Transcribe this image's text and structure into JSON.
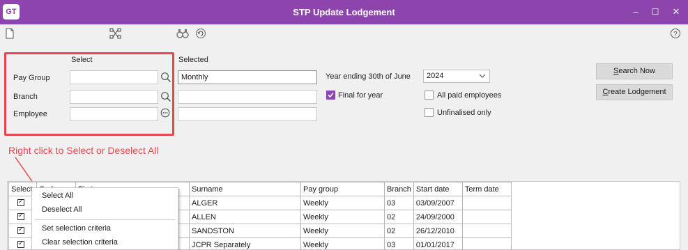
{
  "window": {
    "logo": "GT",
    "title": "STP Update Lodgement",
    "minimize": "–",
    "maximize": "☐",
    "close": "✕"
  },
  "toolbar": {
    "icons": [
      "new-document-icon",
      "hierarchy-icon",
      "binoculars-icon",
      "refresh-icon",
      "help-icon"
    ],
    "help": "?"
  },
  "criteria": {
    "select_header": "Select",
    "selected_header": "Selected",
    "rows": [
      {
        "label": "Pay Group",
        "select_value": "",
        "selected_value": "Monthly"
      },
      {
        "label": "Branch",
        "select_value": "",
        "selected_value": ""
      },
      {
        "label": "Employee",
        "select_value": "",
        "selected_value": ""
      }
    ]
  },
  "options": {
    "year_label": "Year ending 30th of June",
    "year_value": "2024",
    "final_for_year": {
      "label": "Final for year",
      "checked": true
    },
    "all_paid": {
      "label": "All paid employees",
      "checked": false
    },
    "unfinalised": {
      "label": "Unfinalised only",
      "checked": false
    }
  },
  "buttons": {
    "search_now": {
      "underline": "S",
      "rest": "earch Now"
    },
    "create_lodgement": {
      "underline": "C",
      "rest": "reate Lodgement"
    }
  },
  "annotation": "Right click to Select or Deselect All",
  "grid": {
    "columns": [
      "Select",
      "Code",
      "First name",
      "Surname",
      "Pay group",
      "Branch",
      "Start date",
      "Term date"
    ],
    "rows": [
      {
        "surname": "ALGER",
        "pay_group": "Weekly",
        "branch": "03",
        "start_date": "03/09/2007",
        "term_date": ""
      },
      {
        "surname": "ALLEN",
        "pay_group": "Weekly",
        "branch": "02",
        "start_date": "24/09/2000",
        "term_date": ""
      },
      {
        "surname": "SANDSTON",
        "pay_group": "Weekly",
        "branch": "02",
        "start_date": "26/12/2010",
        "term_date": ""
      },
      {
        "surname": "JCPR Separately",
        "pay_group": "Weekly",
        "branch": "03",
        "start_date": "01/01/2017",
        "term_date": ""
      }
    ]
  },
  "context_menu": {
    "items": [
      "Select All",
      "Deselect All",
      "Set selection criteria",
      "Clear selection criteria"
    ]
  },
  "colors": {
    "title_bar": "#8e44ad",
    "annotation": "#e8474a",
    "checkbox_on": "#8e44ad"
  }
}
